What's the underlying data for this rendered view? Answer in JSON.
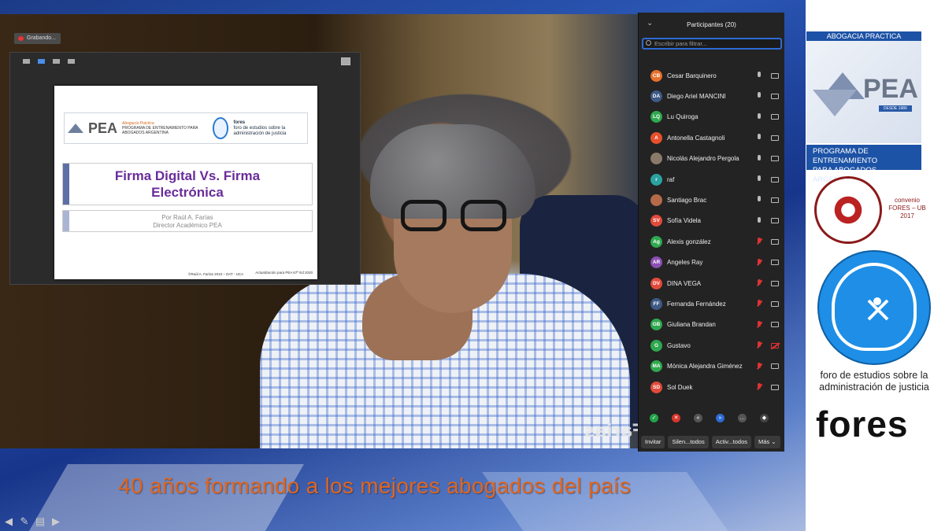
{
  "recording": {
    "label": "Grabando..."
  },
  "slide": {
    "pea_word": "PEA",
    "pea_tag": "Abogacía Práctica",
    "pea_sub": "PROGRAMA DE ENTRENAMIENTO PARA ABOGADOS ARGENTINA",
    "fores_name": "fores",
    "fores_sub": "foro de estudios sobre la administración de justicia",
    "title_line1": "Firma Digital Vs. Firma",
    "title_line2": "Electrónica",
    "author": "Por Raúl A. Farías",
    "role": "Director Académico PEA",
    "footer_left": "©Raúl A. Farías 2010 – DAT - UCA",
    "footer_right": "Actualización para PEA 67º Ed 2020"
  },
  "video": {
    "name_tag": "Farias"
  },
  "participants": {
    "title": "Participantes (20)",
    "filter_placeholder": "Escribir para filtrar...",
    "list": [
      {
        "initials": "CB",
        "name": "Cesar Barquinero",
        "color": "#e6702b",
        "muted": false,
        "cam_off": false
      },
      {
        "initials": "DA",
        "name": "Diego Ariel MANCINI",
        "color": "#3e5a86",
        "muted": false,
        "cam_off": false
      },
      {
        "initials": "LQ",
        "name": "Lu Quiroga",
        "color": "#2fa84f",
        "muted": false,
        "cam_off": false
      },
      {
        "initials": "A",
        "name": "Antonella Castagnoli",
        "color": "#e6502b",
        "muted": false,
        "cam_off": false
      },
      {
        "initials": "",
        "name": "Nicolás Alejandro Pergola",
        "color": "#8a7a6a",
        "muted": false,
        "cam_off": false
      },
      {
        "initials": "r",
        "name": "raf",
        "color": "#2aa3a0",
        "muted": false,
        "cam_off": false
      },
      {
        "initials": "",
        "name": "Santiago Brac",
        "color": "#b56a4a",
        "muted": false,
        "cam_off": false
      },
      {
        "initials": "SV",
        "name": "Sofía Videla",
        "color": "#e24a3a",
        "muted": false,
        "cam_off": false
      },
      {
        "initials": "Ag",
        "name": "Alexis gonzález",
        "color": "#2fa84f",
        "muted": true,
        "cam_off": false
      },
      {
        "initials": "AR",
        "name": "Angeles Ray",
        "color": "#8c4fb3",
        "muted": true,
        "cam_off": false
      },
      {
        "initials": "DV",
        "name": "DINA VEGA",
        "color": "#e24a3a",
        "muted": true,
        "cam_off": false
      },
      {
        "initials": "FF",
        "name": "Fernanda Fernández",
        "color": "#3e5a86",
        "muted": true,
        "cam_off": false
      },
      {
        "initials": "GB",
        "name": "Giuliana Brandan",
        "color": "#2fa84f",
        "muted": true,
        "cam_off": false
      },
      {
        "initials": "G",
        "name": "Gustavo",
        "color": "#2fa84f",
        "muted": true,
        "cam_off": true
      },
      {
        "initials": "MA",
        "name": "Mónica Alejandra Giménez",
        "color": "#2fa84f",
        "muted": true,
        "cam_off": false
      },
      {
        "initials": "SD",
        "name": "Sol Duek",
        "color": "#e24a3a",
        "muted": true,
        "cam_off": false
      }
    ],
    "buttons": {
      "invite": "Invitar",
      "mute_all": "Silen...todos",
      "unmute_all": "Activ...todos",
      "more": "Más ⌄"
    }
  },
  "sidebar": {
    "banner": "ABOGACIA PRACTICA",
    "pea_word": "PEA",
    "pea_since": "DESDE 1980",
    "program_line1": "PROGRAMA DE ENTRENAMIENTO",
    "program_line2a": "PARA ABOGADOS ",
    "program_line2b": "ARGENTINA",
    "ub_convenio": "convenio",
    "ub_line": "FORES – UB",
    "ub_year": "2017",
    "fores_caption": "foro de estudios sobre la administración de justicia",
    "fores_word": "fores"
  },
  "slogan": "40 años formando a los mejores abogados del país"
}
